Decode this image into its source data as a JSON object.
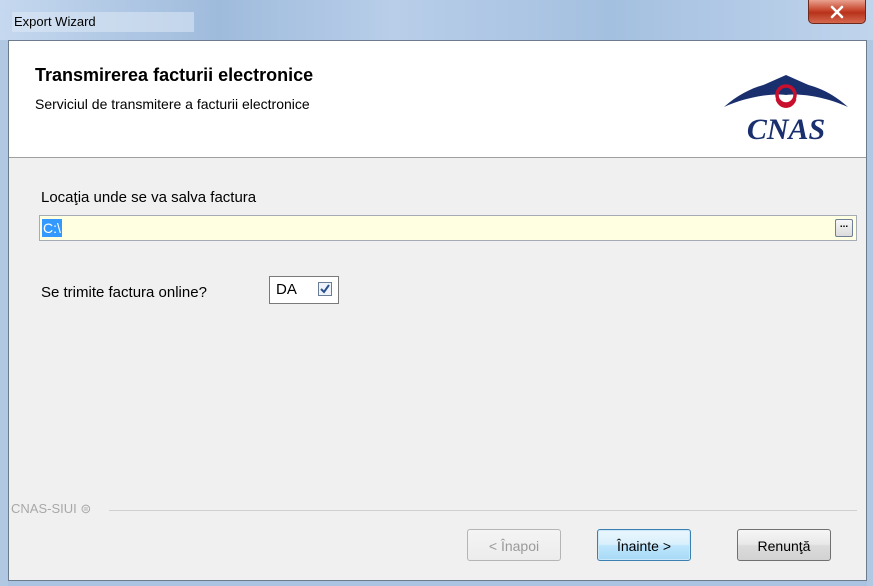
{
  "window": {
    "title": "Export Wizard",
    "close_glyph": "✕"
  },
  "header": {
    "title": "Transmirerea facturii electronice",
    "subtitle": "Serviciul de transmitere a facturii electronice",
    "logo_text": "CNAS"
  },
  "form": {
    "location_label": "Locaţia unde se va salva factura",
    "location_value": "C:\\",
    "browse_label": "...",
    "online_label": "Se trimite factura online?",
    "online_value": "DA",
    "online_checked": true
  },
  "footer": {
    "group_label": "CNAS-SIUI ⊜",
    "back_label": "< Înapoi",
    "next_label": "Înainte >",
    "cancel_label": "Renunţă"
  },
  "colors": {
    "input_background": "#ffffe1",
    "selection": "#3399ff",
    "logo_red": "#c8102e",
    "logo_navy": "#1a2f6e"
  }
}
